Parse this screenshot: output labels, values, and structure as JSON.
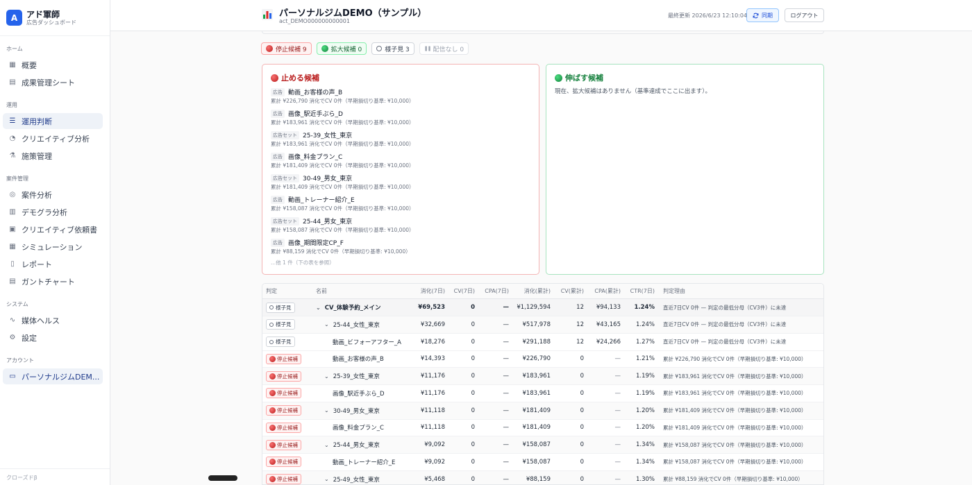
{
  "brand": {
    "logo": "A",
    "title": "アド軍師",
    "subtitle": "広告ダッシュボード"
  },
  "sidebar": {
    "sections": [
      {
        "label": "ホーム",
        "items": [
          {
            "label": "概要",
            "icon": "grid-icon"
          },
          {
            "label": "成果管理シート",
            "icon": "table-icon"
          }
        ]
      },
      {
        "label": "運用",
        "items": [
          {
            "label": "運用判断",
            "icon": "list-check-icon",
            "active": true
          },
          {
            "label": "クリエイティブ分析",
            "icon": "palette-icon"
          },
          {
            "label": "施策管理",
            "icon": "flask-icon"
          }
        ]
      },
      {
        "label": "案件管理",
        "items": [
          {
            "label": "案件分析",
            "icon": "compass-icon"
          },
          {
            "label": "デモグラ分析",
            "icon": "bar-chart-icon"
          },
          {
            "label": "クリエイティブ依頼書",
            "icon": "clapper-icon"
          },
          {
            "label": "シミュレーション",
            "icon": "calculator-icon"
          },
          {
            "label": "レポート",
            "icon": "document-icon"
          },
          {
            "label": "ガントチャート",
            "icon": "gantt-icon"
          }
        ]
      },
      {
        "label": "システム",
        "items": [
          {
            "label": "媒体ヘルス",
            "icon": "activity-icon"
          },
          {
            "label": "設定",
            "icon": "gear-icon"
          }
        ]
      },
      {
        "label": "アカウント",
        "items": [
          {
            "label": "パーソナルジムDEM...",
            "icon": "folder-icon",
            "active": true
          }
        ]
      }
    ],
    "footer": "クローズドβ"
  },
  "header": {
    "title": "パーソナルジムDEMO（サンプル）",
    "account_id": "act_DEMO000000000001",
    "last_updated": "最終更新 2026/6/23 12:10:04",
    "sync_label": "同期",
    "logout_label": "ログアウト"
  },
  "chips": [
    {
      "kind": "stop",
      "label": "停止候補 9"
    },
    {
      "kind": "grow",
      "label": "拡大候補 0"
    },
    {
      "kind": "watch",
      "label": "様子見 3"
    },
    {
      "kind": "none",
      "label": "配信なし 0"
    }
  ],
  "stop_card": {
    "title": "止める候補",
    "items": [
      {
        "tag": "広告",
        "name": "動画_お客様の声_B",
        "detail": "累計 ¥226,790 消化でCV 0件（早期損切り基準: ¥10,000）"
      },
      {
        "tag": "広告",
        "name": "画像_駅近手ぶら_D",
        "detail": "累計 ¥183,961 消化でCV 0件（早期損切り基準: ¥10,000）"
      },
      {
        "tag": "広告セット",
        "name": "25-39_女性_東京",
        "detail": "累計 ¥183,961 消化でCV 0件（早期損切り基準: ¥10,000）"
      },
      {
        "tag": "広告",
        "name": "画像_料金プラン_C",
        "detail": "累計 ¥181,409 消化でCV 0件（早期損切り基準: ¥10,000）"
      },
      {
        "tag": "広告セット",
        "name": "30-49_男女_東京",
        "detail": "累計 ¥181,409 消化でCV 0件（早期損切り基準: ¥10,000）"
      },
      {
        "tag": "広告",
        "name": "動画_トレーナー紹介_E",
        "detail": "累計 ¥158,087 消化でCV 0件（早期損切り基準: ¥10,000）"
      },
      {
        "tag": "広告セット",
        "name": "25-44_男女_東京",
        "detail": "累計 ¥158,087 消化でCV 0件（早期損切り基準: ¥10,000）"
      },
      {
        "tag": "広告",
        "name": "画像_期間限定CP_F",
        "detail": "累計 ¥88,159 消化でCV 0件（早期損切り基準: ¥10,000）"
      }
    ],
    "more": "...他 1 件（下の表を参照）"
  },
  "grow_card": {
    "title": "伸ばす候補",
    "empty": "現在、拡大候補はありません（基準達成でここに出ます）。"
  },
  "table": {
    "headers": {
      "judge": "判定",
      "name": "名前",
      "spend7": "消化(7日)",
      "cv7": "CV(7日)",
      "cpa7": "CPA(7日)",
      "spend_cum": "消化(累計)",
      "cv_cum": "CV(累計)",
      "cpa_cum": "CPA(累計)",
      "ctr7": "CTR(7日)",
      "reason": "判定理由"
    },
    "rows": [
      {
        "level": 0,
        "badge": "watch",
        "badge_label": "様子見",
        "name": "CV_体験予約_メイン",
        "spend7": "¥69,523",
        "cv7": "0",
        "cpa7": "—",
        "spend_cum": "¥1,129,594",
        "cv_cum": "12",
        "cpa_cum": "¥94,133",
        "ctr7": "1.24%",
        "reason": "直近7日CV 0件 — 判定の最低分母（CV3件）に未達"
      },
      {
        "level": 1,
        "badge": "watch",
        "badge_label": "様子見",
        "name": "25-44_女性_東京",
        "spend7": "¥32,669",
        "cv7": "0",
        "cpa7": "—",
        "spend_cum": "¥517,978",
        "cv_cum": "12",
        "cpa_cum": "¥43,165",
        "ctr7": "1.24%",
        "reason": "直近7日CV 0件 — 判定の最低分母（CV3件）に未達"
      },
      {
        "level": 2,
        "badge": "watch",
        "badge_label": "様子見",
        "name": "動画_ビフォーアフター_A",
        "spend7": "¥18,276",
        "cv7": "0",
        "cpa7": "—",
        "spend_cum": "¥291,188",
        "cv_cum": "12",
        "cpa_cum": "¥24,266",
        "ctr7": "1.27%",
        "reason": "直近7日CV 0件 — 判定の最低分母（CV3件）に未達"
      },
      {
        "level": 2,
        "badge": "stop",
        "badge_label": "停止候補",
        "name": "動画_お客様の声_B",
        "spend7": "¥14,393",
        "cv7": "0",
        "cpa7": "—",
        "spend_cum": "¥226,790",
        "cv_cum": "0",
        "cpa_cum": "—",
        "ctr7": "1.21%",
        "reason": "累計 ¥226,790 消化でCV 0件（早期損切り基準: ¥10,000）"
      },
      {
        "level": 1,
        "badge": "stop",
        "badge_label": "停止候補",
        "name": "25-39_女性_東京",
        "spend7": "¥11,176",
        "cv7": "0",
        "cpa7": "—",
        "spend_cum": "¥183,961",
        "cv_cum": "0",
        "cpa_cum": "—",
        "ctr7": "1.19%",
        "reason": "累計 ¥183,961 消化でCV 0件（早期損切り基準: ¥10,000）"
      },
      {
        "level": 2,
        "badge": "stop",
        "badge_label": "停止候補",
        "name": "画像_駅近手ぶら_D",
        "spend7": "¥11,176",
        "cv7": "0",
        "cpa7": "—",
        "spend_cum": "¥183,961",
        "cv_cum": "0",
        "cpa_cum": "—",
        "ctr7": "1.19%",
        "reason": "累計 ¥183,961 消化でCV 0件（早期損切り基準: ¥10,000）"
      },
      {
        "level": 1,
        "badge": "stop",
        "badge_label": "停止候補",
        "name": "30-49_男女_東京",
        "spend7": "¥11,118",
        "cv7": "0",
        "cpa7": "—",
        "spend_cum": "¥181,409",
        "cv_cum": "0",
        "cpa_cum": "—",
        "ctr7": "1.20%",
        "reason": "累計 ¥181,409 消化でCV 0件（早期損切り基準: ¥10,000）"
      },
      {
        "level": 2,
        "badge": "stop",
        "badge_label": "停止候補",
        "name": "画像_料金プラン_C",
        "spend7": "¥11,118",
        "cv7": "0",
        "cpa7": "—",
        "spend_cum": "¥181,409",
        "cv_cum": "0",
        "cpa_cum": "—",
        "ctr7": "1.20%",
        "reason": "累計 ¥181,409 消化でCV 0件（早期損切り基準: ¥10,000）"
      },
      {
        "level": 1,
        "badge": "stop",
        "badge_label": "停止候補",
        "name": "25-44_男女_東京",
        "spend7": "¥9,092",
        "cv7": "0",
        "cpa7": "—",
        "spend_cum": "¥158,087",
        "cv_cum": "0",
        "cpa_cum": "—",
        "ctr7": "1.34%",
        "reason": "累計 ¥158,087 消化でCV 0件（早期損切り基準: ¥10,000）"
      },
      {
        "level": 2,
        "badge": "stop",
        "badge_label": "停止候補",
        "name": "動画_トレーナー紹介_E",
        "spend7": "¥9,092",
        "cv7": "0",
        "cpa7": "—",
        "spend_cum": "¥158,087",
        "cv_cum": "0",
        "cpa_cum": "—",
        "ctr7": "1.34%",
        "reason": "累計 ¥158,087 消化でCV 0件（早期損切り基準: ¥10,000）"
      },
      {
        "level": 1,
        "badge": "stop",
        "badge_label": "停止候補",
        "name": "25-49_女性_東京",
        "spend7": "¥5,468",
        "cv7": "0",
        "cpa7": "—",
        "spend_cum": "¥88,159",
        "cv_cum": "0",
        "cpa_cum": "—",
        "ctr7": "1.30%",
        "reason": "累計 ¥88,159 消化でCV 0件（早期損切り基準: ¥10,000）"
      }
    ]
  }
}
